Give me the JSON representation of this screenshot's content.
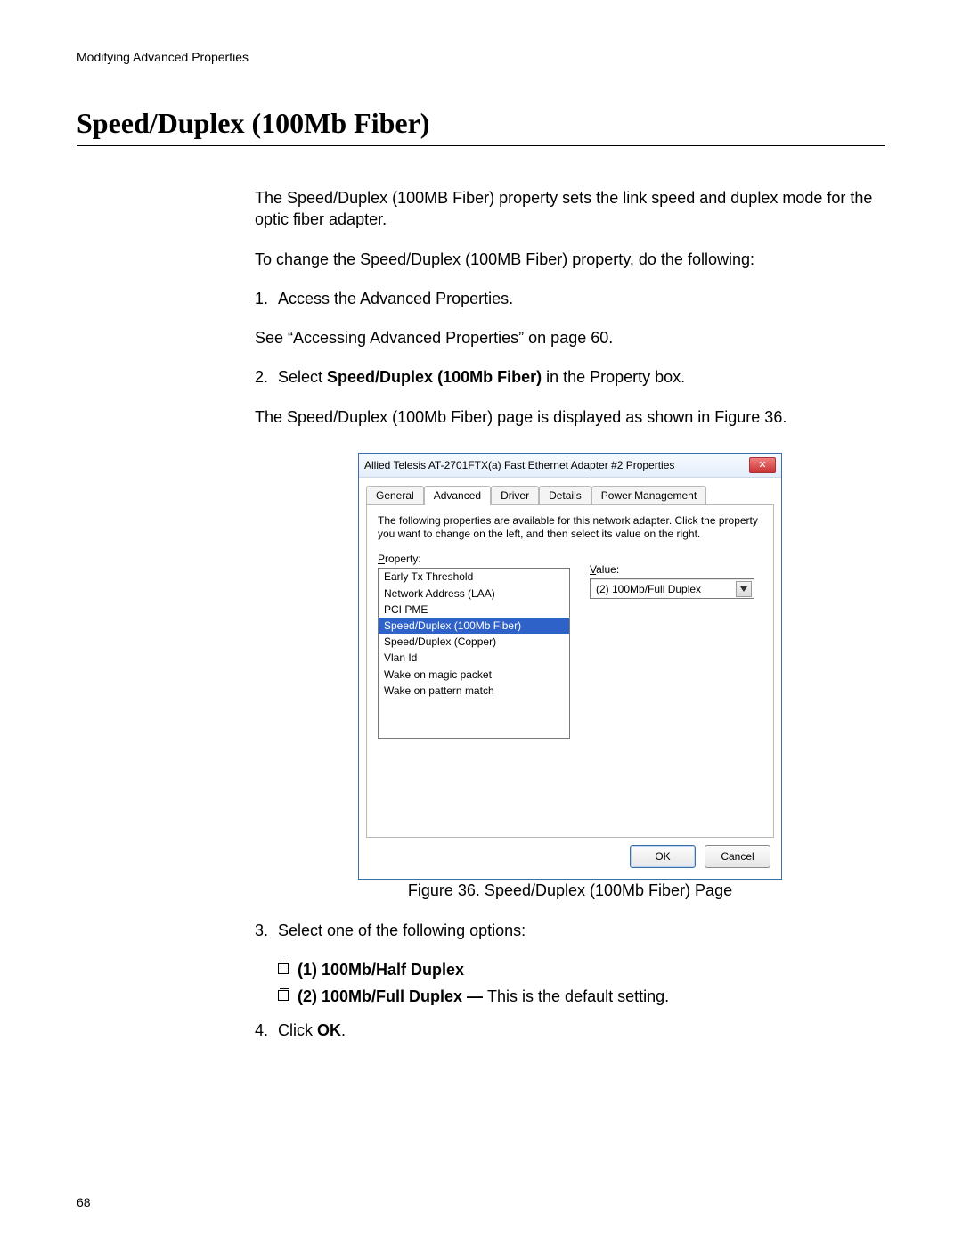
{
  "header": {
    "running": "Modifying Advanced Properties"
  },
  "page_number": "68",
  "title": "Speed/Duplex (100Mb Fiber)",
  "intro1": "The Speed/Duplex (100MB Fiber) property sets the link speed and duplex mode for the optic fiber adapter.",
  "intro2": "To change the Speed/Duplex (100MB Fiber) property, do the following:",
  "steps": {
    "s1_num": "1.",
    "s1_text": "Access the Advanced Properties.",
    "s1_sub": "See “Accessing Advanced Properties” on page 60.",
    "s2_num": "2.",
    "s2_pre": "Select ",
    "s2_bold": "Speed/Duplex (100Mb Fiber)",
    "s2_post": " in the Property box.",
    "s2_sub": "The Speed/Duplex (100Mb Fiber) page is displayed as shown in Figure 36.",
    "s3_num": "3.",
    "s3_text": "Select one of the following options:",
    "opt1": "(1) 100Mb/Half Duplex",
    "opt2_bold": "(2) 100Mb/Full Duplex — ",
    "opt2_rest": "This is the default setting.",
    "s4_num": "4.",
    "s4_pre": "Click ",
    "s4_bold": "OK",
    "s4_post": "."
  },
  "figure_caption": "Figure 36. Speed/Duplex (100Mb Fiber) Page",
  "dialog": {
    "title": "Allied Telesis AT-2701FTX(a) Fast Ethernet Adapter #2 Properties",
    "close_name": "close-icon",
    "tabs": {
      "general": "General",
      "advanced": "Advanced",
      "driver": "Driver",
      "details": "Details",
      "power": "Power Management"
    },
    "description": "The following properties are available for this network adapter. Click the property you want to change on the left, and then select its value on the right.",
    "property_label_pre": "P",
    "property_label_post": "roperty:",
    "value_label_pre": "V",
    "value_label_post": "alue:",
    "properties": [
      "Early Tx Threshold",
      "Network Address (LAA)",
      "PCI PME",
      "Speed/Duplex (100Mb Fiber)",
      "Speed/Duplex (Copper)",
      "Vlan Id",
      "Wake on magic packet",
      "Wake on pattern match"
    ],
    "selected_index": 3,
    "value": "(2) 100Mb/Full Duplex",
    "ok": "OK",
    "cancel": "Cancel"
  }
}
